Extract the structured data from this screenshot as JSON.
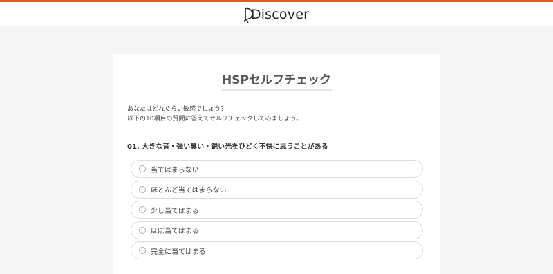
{
  "header": {
    "logo_text": "Discover",
    "accent_color": "#e8552d"
  },
  "quiz": {
    "title": "HSPセルフチェック",
    "intro_line1": "あなたはどれぐらい敏感でしょう？",
    "intro_line2": "以下の10項目の質問に答えてセルフチェックしてみましょう。",
    "question": "01. 大きな音・強い臭い・鋭い光をひどく不快に思うことがある",
    "options": [
      {
        "label": "当てはまらない"
      },
      {
        "label": "ほとんど当てはまらない"
      },
      {
        "label": "少し当てはまる"
      },
      {
        "label": "ほぼ当てはまる"
      },
      {
        "label": "完全に当てはまる"
      }
    ]
  }
}
